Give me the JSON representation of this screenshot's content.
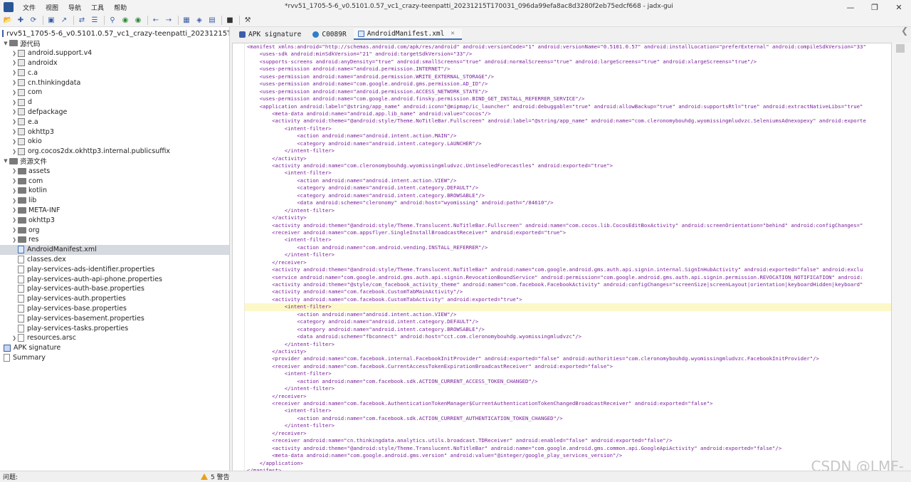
{
  "window": {
    "title": "*rvv51_1705-5-6_v0.5101.0.57_vc1_crazy-teenpatti_20231215T170031_096da99efa8ac8d3280f2eb75edcf668 - jadx-gui",
    "menu": [
      "文件",
      "视图",
      "导航",
      "工具",
      "帮助"
    ]
  },
  "toolbar": {
    "buttons": [
      "open-icon",
      "add-icon",
      "refresh-icon",
      "save-icon",
      "export-icon",
      "sync-icon",
      "collapse-icon",
      "search-icon",
      "search-class-icon",
      "search-usage-icon",
      "back-icon",
      "forward-icon",
      "decompile-icon",
      "quark-icon",
      "log-icon",
      "deobf-icon",
      "settings-icon"
    ]
  },
  "tree": {
    "root": "rvv51_1705-5-6_v0.5101.0.57_vc1_crazy-teenpatti_20231215T1",
    "source_section": "源代码",
    "source_items": [
      "android.support.v4",
      "androidx",
      "c.a",
      "cn.thinkingdata",
      "com",
      "d",
      "defpackage",
      "e.a",
      "okhttp3",
      "okio",
      "org.cocos2dx.okhttp3.internal.publicsuffix"
    ],
    "resources_section": "资源文件",
    "resource_folders": [
      "assets",
      "com",
      "kotlin",
      "lib",
      "META-INF",
      "okhttp3",
      "org",
      "res"
    ],
    "resource_files": [
      "AndroidManifest.xml",
      "classes.dex",
      "play-services-ads-identifier.properties",
      "play-services-auth-api-phone.properties",
      "play-services-auth-base.properties",
      "play-services-auth.properties",
      "play-services-base.properties",
      "play-services-basement.properties",
      "play-services-tasks.properties"
    ],
    "resource_tail": "resources.arsc",
    "apk_signature": "APK signature",
    "summary": "Summary"
  },
  "tabs": [
    {
      "label": "APK signature"
    },
    {
      "label": "C0089R"
    },
    {
      "label": "AndroidManifest.xml"
    }
  ],
  "editor": {
    "highlighted_line_number": "109",
    "lines": [
      {
        "n": "1",
        "t": "<manifest xmlns:android=\"http://schemas.android.com/apk/res/android\" android:versionCode=\"1\" android:versionName=\"0.5101.0.57\" android:installLocation=\"preferExternal\" android:compileSdkVersion=\"33\""
      },
      {
        "n": "8",
        "t": "    <uses-sdk android:minSdkVersion=\"21\" android:targetSdkVersion=\"33\"/>"
      },
      {
        "n": "12",
        "t": "    <supports-screens android:anyDensity=\"true\" android:smallScreens=\"true\" android:normalScreens=\"true\" android:largeScreens=\"true\" android:xlargeScreens=\"true\"/>"
      },
      {
        "n": "19",
        "t": "    <uses-permission android:name=\"android.permission.INTERNET\"/>"
      },
      {
        "n": "20",
        "t": "    <uses-permission android:name=\"android.permission.WRITE_EXTERNAL_STORAGE\"/>"
      },
      {
        "n": "21",
        "t": "    <uses-permission android:name=\"com.google.android.gms.permission.AD_ID\"/>"
      },
      {
        "n": "22",
        "t": "    <uses-permission android:name=\"android.permission.ACCESS_NETWORK_STATE\"/>"
      },
      {
        "n": "23",
        "t": "    <uses-permission android:name=\"com.google.android.finsky.permission.BIND_GET_INSTALL_REFERRER_SERVICE\"/>"
      },
      {
        "n": "26",
        "t": "    <application android:label=\"@string/app_name\" android:icon=\"@mipmap/ic_launcher\" android:debuggable=\"true\" android:allowBackup=\"true\" android:supportsRtl=\"true\" android:extractNativeLibs=\"true\""
      },
      {
        "n": "38",
        "t": "        <meta-data android:name=\"android.app.lib_name\" android:value=\"cocos\"/>"
      },
      {
        "n": "42",
        "t": "        <activity android:theme=\"@android:style/Theme.NoTitleBar.Fullscreen\" android:label=\"@string/app_name\" android:name=\"com.cleronomybouhdg.wyomissingmludvzc.SeleniumsAdnexopexy\" android:exporte"
      },
      {
        "n": "50",
        "t": "            <intent-filter>"
      },
      {
        "n": "51",
        "t": "                <action android:name=\"android.intent.action.MAIN\"/>"
      },
      {
        "n": "52",
        "t": "                <category android:name=\"android.intent.category.LAUNCHER\"/>"
      },
      {
        "n": "50",
        "t": "            </intent-filter>"
      },
      {
        "n": "42",
        "t": "        </activity>"
      },
      {
        "n": "57",
        "t": "        <activity android:name=\"com.cleronomybouhdg.wyomissingmludvzc.UntinseledForecastles\" android:exported=\"true\">"
      },
      {
        "n": "60",
        "t": "            <intent-filter>"
      },
      {
        "n": "61",
        "t": "                <action android:name=\"android.intent.action.VIEW\"/>"
      },
      {
        "n": "63",
        "t": "                <category android:name=\"android.intent.category.DEFAULT\"/>"
      },
      {
        "n": "64",
        "t": "                <category android:name=\"android.intent.category.BROWSABLE\"/>"
      },
      {
        "n": "66",
        "t": "                <data android:scheme=\"cleronomy\" android:host=\"wyomissing\" android:path=\"/84610\"/>"
      },
      {
        "n": "60",
        "t": "            </intent-filter>"
      },
      {
        "n": "57",
        "t": "        </activity>"
      },
      {
        "n": "72",
        "t": "        <activity android:theme=\"@android:style/Theme.Translucent.NoTitleBar.Fullscreen\" android:name=\"com.cocos.lib.CocosEditBoxActivity\" android:screenOrientation=\"behind\" android:configChanges=\""
      },
      {
        "n": "76",
        "t": "        <receiver android:name=\"com.appsflyer.SingleInstallBroadcastReceiver\" android:exported=\"true\">"
      },
      {
        "n": "82",
        "t": "            <intent-filter>"
      },
      {
        "n": "83",
        "t": "                <action android:name=\"com.android.vending.INSTALL_REFERRER\"/>"
      },
      {
        "n": "82",
        "t": "            </intent-filter>"
      },
      {
        "n": "76",
        "t": "        </receiver>"
      },
      {
        "n": "87",
        "t": "        <activity android:theme=\"@android:style/Theme.Translucent.NoTitleBar\" android:name=\"com.google.android.gms.auth.api.signin.internal.SignInHubActivity\" android:exported=\"false\" android:exclu"
      },
      {
        "n": "93",
        "t": "        <service android:name=\"com.google.android.gms.auth.api.signin.RevocationBoundService\" android:permission=\"com.google.android.gms.auth.api.signin.permission.REVOCATION_NOTIFICATION\" android:"
      },
      {
        "n": "101",
        "t": "        <activity android:theme=\"@style/com_facebook_activity_theme\" android:name=\"com.facebook.FacebookActivity\" android:configChanges=\"screenSize|screenLayout|orientation|keyboardHidden|keyboard\""
      },
      {
        "n": "104",
        "t": "        <activity android:name=\"com.facebook.CustomTabMainActivity\"/>"
      },
      {
        "n": "105",
        "t": "        <activity android:name=\"com.facebook.CustomTabActivity\" android:exported=\"true\">"
      },
      {
        "n": "109",
        "t": "            <intent-filter>"
      },
      {
        "n": "110",
        "t": "                <action android:name=\"android.intent.action.VIEW\"/>"
      },
      {
        "n": "112",
        "t": "                <category android:name=\"android.intent.category.DEFAULT\"/>"
      },
      {
        "n": "113",
        "t": "                <category android:name=\"android.intent.category.BROWSABLE\"/>"
      },
      {
        "n": "115",
        "t": "                <data android:scheme=\"fbconnect\" android:host=\"cct.com.cleronomybouhdg.wyomissingmludvzc\"/>"
      },
      {
        "n": "109",
        "t": "            </intent-filter>"
      },
      {
        "n": "105",
        "t": "        </activity>"
      },
      {
        "n": "129",
        "t": "        <provider android:name=\"com.facebook.internal.FacebookInitProvider\" android:exported=\"false\" android:authorities=\"com.cleronomybouhdg.wyomissingmludvzc.FacebookInitProvider\"/>"
      },
      {
        "n": "134",
        "t": "        <receiver android:name=\"com.facebook.CurrentAccessTokenExpirationBroadcastReceiver\" android:exported=\"false\">"
      },
      {
        "n": "137",
        "t": "            <intent-filter>"
      },
      {
        "n": "138",
        "t": "                <action android:name=\"com.facebook.sdk.ACTION_CURRENT_ACCESS_TOKEN_CHANGED\"/>"
      },
      {
        "n": "137",
        "t": "            </intent-filter>"
      },
      {
        "n": "134",
        "t": "        </receiver>"
      },
      {
        "n": "141",
        "t": "        <receiver android:name=\"com.facebook.AuthenticationTokenManager$CurrentAuthenticationTokenChangedBroadcastReceiver\" android:exported=\"false\">"
      },
      {
        "n": "144",
        "t": "            <intent-filter>"
      },
      {
        "n": "145",
        "t": "                <action android:name=\"com.facebook.sdk.ACTION_CURRENT_AUTHENTICATION_TOKEN_CHANGED\"/>"
      },
      {
        "n": "144",
        "t": "            </intent-filter>"
      },
      {
        "n": "141",
        "t": "        </receiver>"
      },
      {
        "n": "148",
        "t": "        <receiver android:name=\"cn.thinkingdata.analytics.utils.broadcast.TDReceiver\" android:enabled=\"false\" android:exported=\"false\"/>"
      },
      {
        "n": "153",
        "t": "        <activity android:theme=\"@android:style/Theme.Translucent.NoTitleBar\" android:name=\"com.google.android.gms.common.api.GoogleApiActivity\" android:exported=\"false\"/>"
      },
      {
        "n": "158",
        "t": "        <meta-data android:name=\"com.google.android.gms.version\" android:value=\"@integer/google_play_services_version\"/>"
      },
      {
        "n": "26",
        "t": "    </application>"
      },
      {
        "n": "2",
        "t": "</manifest>"
      }
    ]
  },
  "status": {
    "left": "问题:",
    "warnings": "5 警告"
  },
  "watermark": "CSDN @LMF-"
}
